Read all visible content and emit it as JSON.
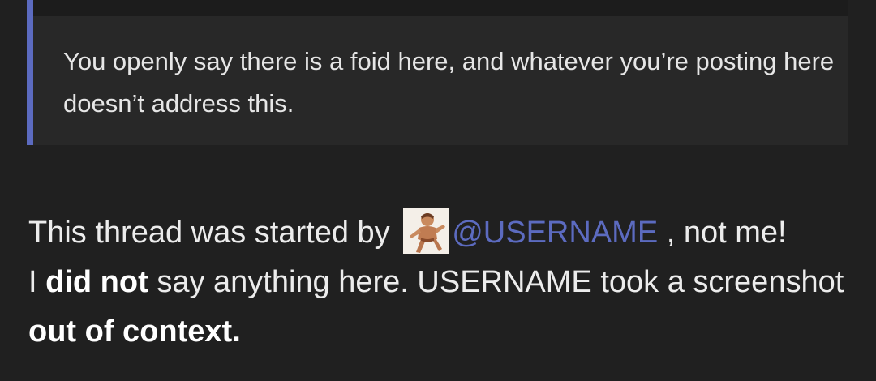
{
  "quote": {
    "text": "You openly say there is a foid here, and whatever you’re posting here doesn’t address this.",
    "accent_color": "#5c6bc0"
  },
  "reply": {
    "part1": "This thread was started by",
    "avatar_icon": "user-avatar-icon",
    "mention": "@USERNAME",
    "part2": ", not me!",
    "part3": "I",
    "bold1": "did not",
    "part4": "say anything here. USERNAME took a screenshot",
    "bold2": "out of context."
  },
  "colors": {
    "background": "#202020",
    "quote_background": "#282828",
    "text": "#ececec",
    "mention": "#5c6bc0"
  }
}
